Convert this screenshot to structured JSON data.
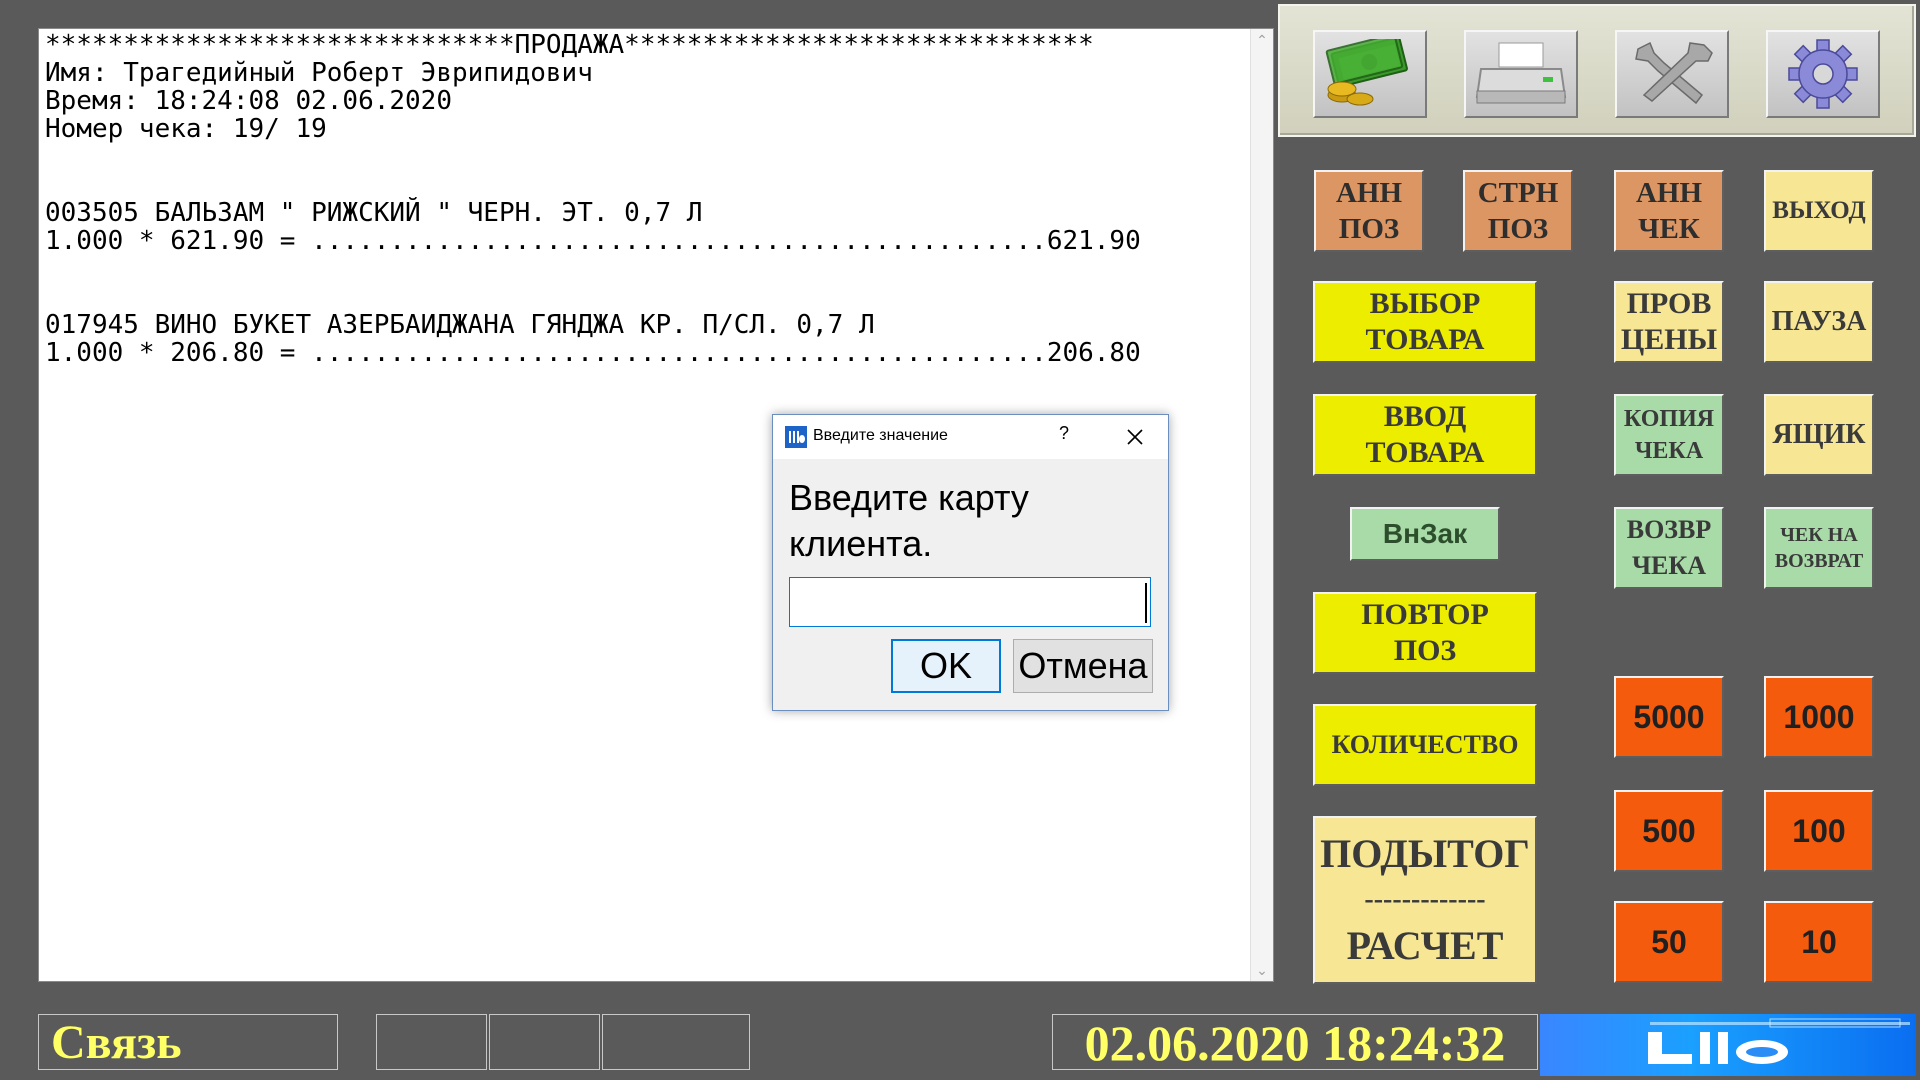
{
  "receipt": {
    "lines": [
      "******************************ПРОДАЖА******************************",
      "Имя: Трагедийный Роберт Эврипидович",
      "Время: 18:24:08 02.06.2020",
      "Номер чека: 19/ 19",
      "",
      "",
      "003505 БАЛЬЗАМ \" РИЖСКИЙ \" ЧЕРН. ЭТ. 0,7 Л",
      "1.000 * 621.90 = ...............................................621.90",
      "",
      "",
      "017945 ВИНО БУКЕТ АЗЕРБАИДЖАНА ГЯНДЖА КР. П/СЛ. 0,7 Л",
      "1.000 * 206.80 = ...............................................206.80"
    ]
  },
  "toolbar": {
    "icons": [
      "money-icon",
      "printer-icon",
      "wrench-icon",
      "gear-icon"
    ]
  },
  "keys": {
    "ann_poz": "АНН\nПОЗ",
    "strn_poz": "СТРН\nПОЗ",
    "ann_chek": "АНН\nЧЕК",
    "exit": "ВЫХОД",
    "select_goods": "ВЫБОР\nТОВАРА",
    "check_price": "ПРОВ\nЦЕНЫ",
    "pause": "ПАУЗА",
    "input_goods": "ВВОД\nТОВАРА",
    "receipt_copy": "КОПИЯ\nЧЕКА",
    "drawer": "ЯЩИК",
    "vnzak": "ВнЗак",
    "return_receipt": "ВОЗВР\nЧЕКА",
    "return_check": "ЧЕК НА\nВОЗВРАТ",
    "repeat_poz": "ПОВТОР\nПОЗ",
    "quantity": "КОЛИЧЕСТВО",
    "subtotal": "ПОДЫТОГ",
    "subtotal_divider": "-------------",
    "payment": "РАСЧЕТ",
    "n5000": "5000",
    "n1000": "1000",
    "n500": "500",
    "n100": "100",
    "n50": "50",
    "n10": "10"
  },
  "status": {
    "link": "Связь",
    "datetime": "02.06.2020 18:24:32",
    "logo": "Lillo"
  },
  "dialog": {
    "title": "Введите значение",
    "help": "?",
    "prompt": "Введите карту клиента.",
    "input_value": "",
    "ok": "OK",
    "cancel": "Отмена"
  },
  "colors": {
    "background": "#5a5a5a",
    "orange": "#dc9664",
    "cream": "#f7e693",
    "yellow": "#eded00",
    "green": "#a8dba8",
    "red": "#f55b0c",
    "status_text": "#ffff66"
  }
}
